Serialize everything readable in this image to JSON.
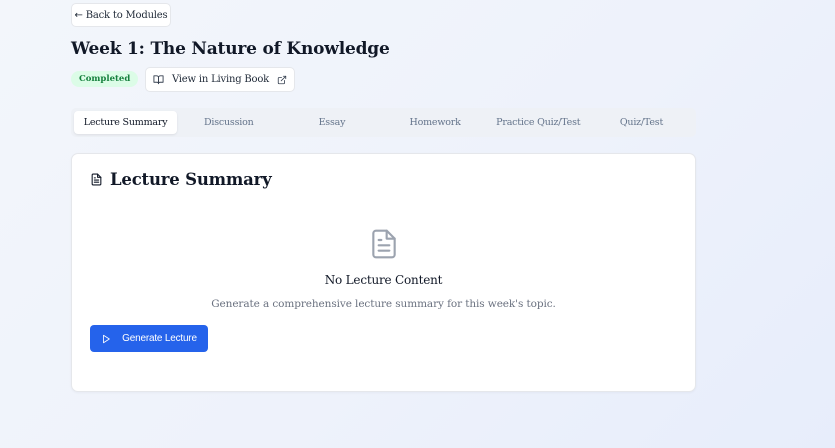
{
  "nav": {
    "back_label": "Back to Modules",
    "back_icon": "arrow-left-icon"
  },
  "header": {
    "title": "Week 1: The Nature of Knowledge",
    "status": "Completed",
    "status_colors": {
      "background": "#dcfce7",
      "text": "#15803d"
    },
    "living_book_label": "View in Living Book",
    "living_book_icon": "book-open-icon",
    "external_icon": "external-link-icon"
  },
  "tabs": [
    {
      "label": "Lecture Summary",
      "active": true
    },
    {
      "label": "Discussion",
      "active": false
    },
    {
      "label": "Essay",
      "active": false
    },
    {
      "label": "Homework",
      "active": false
    },
    {
      "label": "Practice Quiz/Test",
      "active": false
    },
    {
      "label": "Quiz/Test",
      "active": false
    }
  ],
  "card": {
    "title": "Lecture Summary",
    "title_icon": "file-text-icon",
    "empty_icon": "file-text-icon",
    "empty_title": "No Lecture Content",
    "empty_description": "Generate a comprehensive lecture summary for this week's topic.",
    "generate_label": "Generate Lecture",
    "generate_icon": "play-icon"
  },
  "colors": {
    "accent": "#2563eb",
    "muted_text": "#6b7280"
  }
}
